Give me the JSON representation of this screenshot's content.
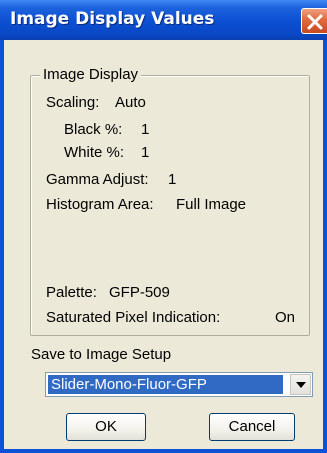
{
  "window": {
    "title": "Image Display Values"
  },
  "group": {
    "title": "Image Display",
    "scaling_label": "Scaling:",
    "scaling_value": "Auto",
    "black_label": "Black %:",
    "black_value": "1",
    "white_label": "White %:",
    "white_value": "1",
    "gamma_label": "Gamma Adjust:",
    "gamma_value": "1",
    "histogram_label": "Histogram Area:",
    "histogram_value": "Full Image",
    "palette_label": "Palette:",
    "palette_value": "GFP-509",
    "saturated_label": "Saturated Pixel Indication:",
    "saturated_value": "On"
  },
  "save": {
    "label": "Save to Image Setup",
    "selected": "Slider-Mono-Fluor-GFP"
  },
  "buttons": {
    "ok": "OK",
    "cancel": "Cancel"
  },
  "icons": {
    "close": "close-icon",
    "dropdown": "chevron-down-icon"
  },
  "colors": {
    "titlebar": "#0b4fd2",
    "close": "#e06a3d",
    "selection": "#316ac5",
    "dialog": "#ece9d8"
  }
}
